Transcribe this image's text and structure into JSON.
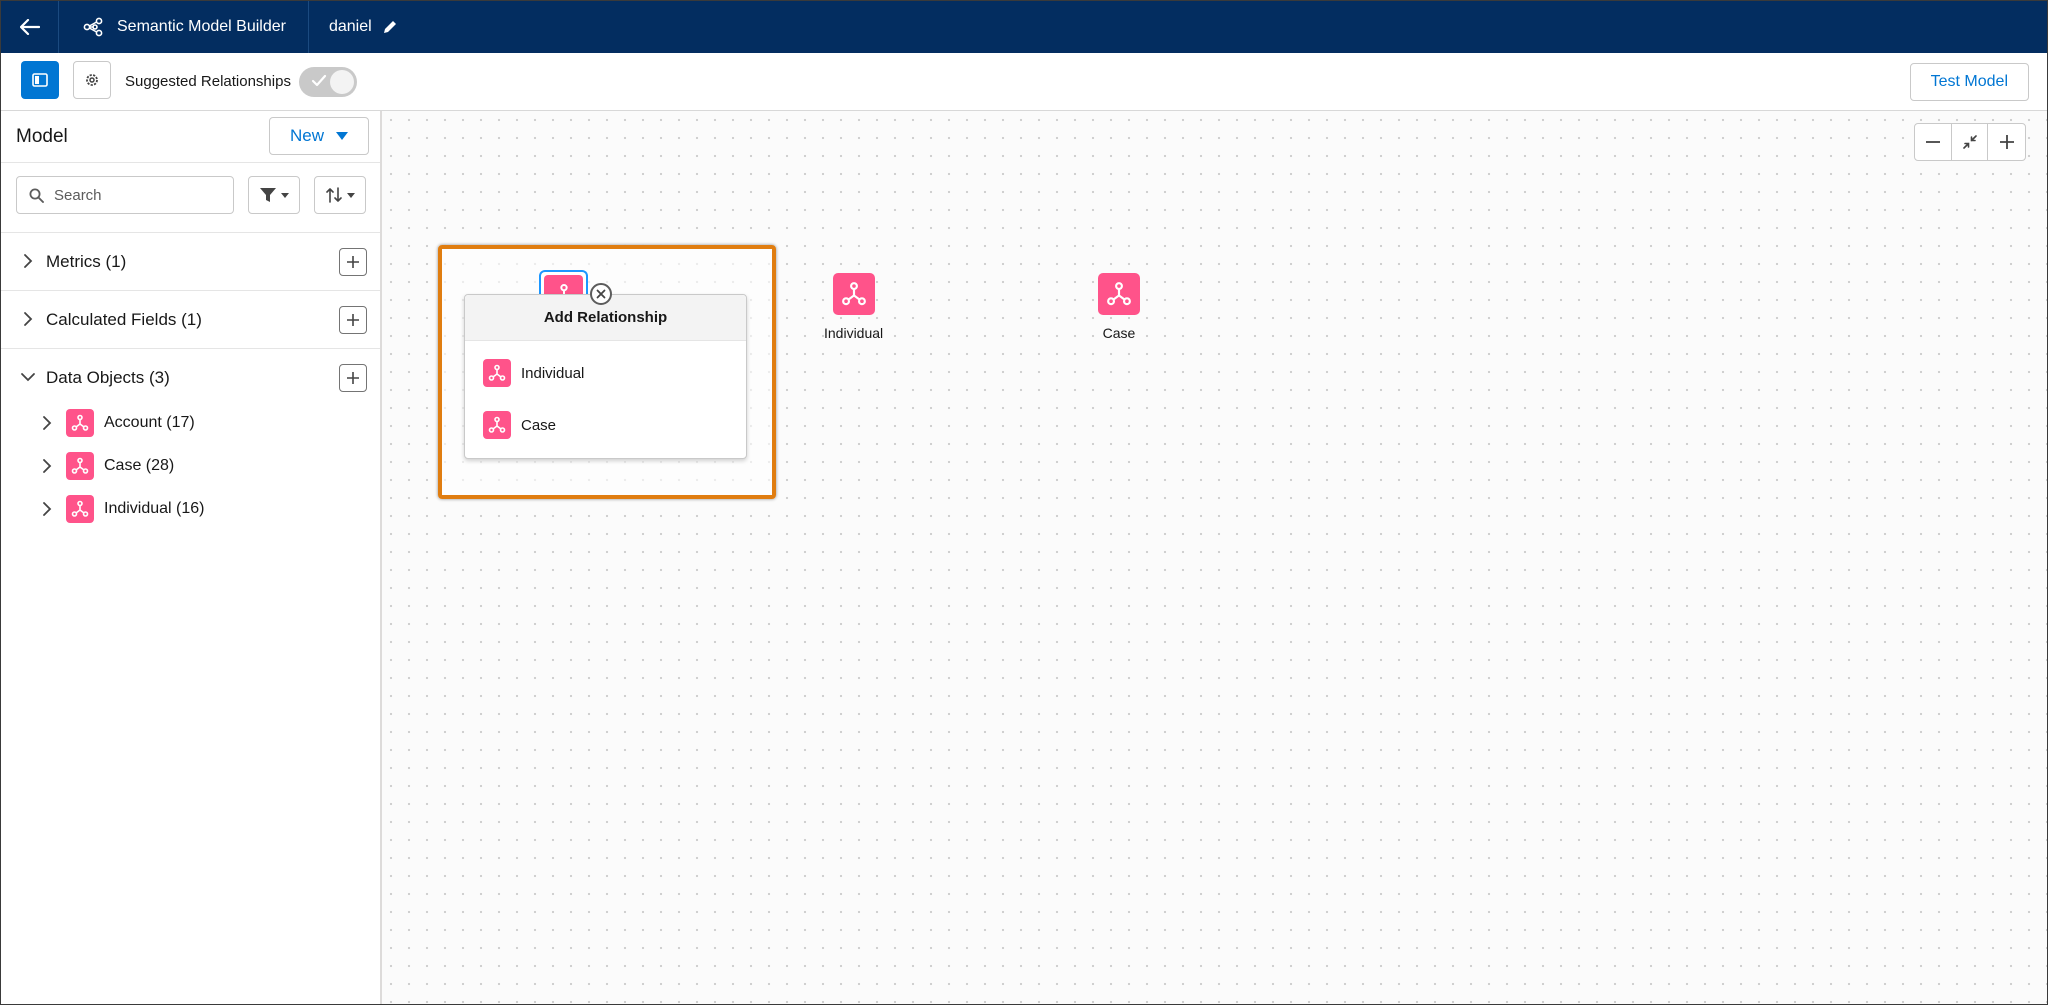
{
  "header": {
    "app_title": "Semantic Model Builder",
    "model_name": "daniel",
    "brand_color": "#032d60"
  },
  "toolbar": {
    "suggested_label": "Suggested Relationships",
    "test_model_label": "Test Model"
  },
  "sidebar": {
    "title": "Model",
    "new_label": "New",
    "search_placeholder": "Search",
    "sections": [
      {
        "label": "Metrics (1)"
      },
      {
        "label": "Calculated Fields (1)"
      },
      {
        "label": "Data Objects (3)"
      }
    ],
    "data_objects": [
      {
        "label": "Account (17)"
      },
      {
        "label": "Case (28)"
      },
      {
        "label": "Individual (16)"
      }
    ]
  },
  "canvas": {
    "nodes": [
      {
        "label": "Individual"
      },
      {
        "label": "Case"
      }
    ],
    "popover": {
      "title": "Add Relationship",
      "items": [
        {
          "label": "Individual"
        },
        {
          "label": "Case"
        }
      ]
    },
    "highlight_color": "#e07d10",
    "object_icon_color": "#ff538a"
  }
}
